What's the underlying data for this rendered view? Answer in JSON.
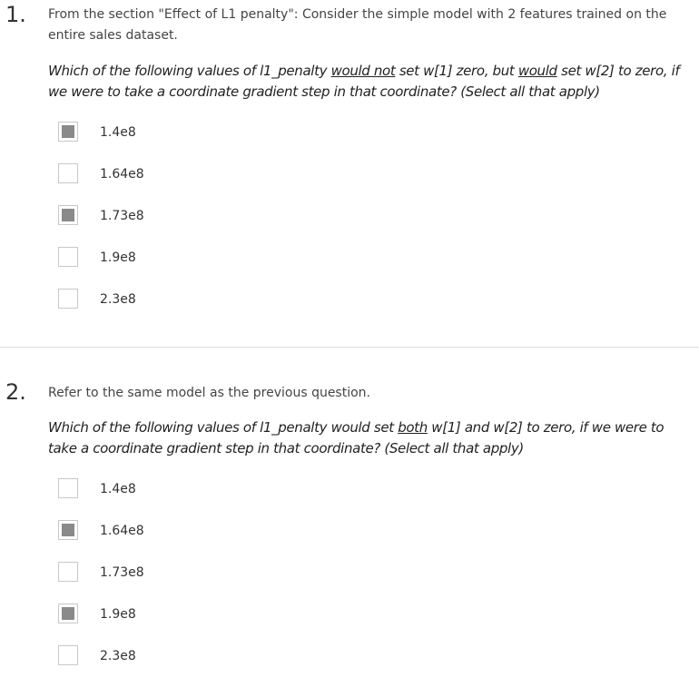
{
  "questions": [
    {
      "number": "1.",
      "intro": "From the section \"Effect of L1 penalty\": Consider the simple model with 2 features trained on the entire sales dataset.",
      "prompt_parts": [
        "Which of the following values of l1_penalty ",
        "would not",
        " set w[1] zero, but ",
        "would",
        " set w[2] to zero, if we were to take a coordinate gradient step in that coordinate? (Select all that apply)"
      ],
      "options": [
        {
          "label": "1.4e8",
          "checked": true
        },
        {
          "label": "1.64e8",
          "checked": false
        },
        {
          "label": "1.73e8",
          "checked": true
        },
        {
          "label": "1.9e8",
          "checked": false
        },
        {
          "label": "2.3e8",
          "checked": false
        }
      ]
    },
    {
      "number": "2.",
      "intro": "Refer to the same model as the previous question.",
      "prompt_parts": [
        "Which of the following values of l1_penalty would set ",
        "both",
        " w[1] and w[2] to zero, if we were to take a coordinate gradient step in that coordinate? (Select all that apply)"
      ],
      "options": [
        {
          "label": "1.4e8",
          "checked": false
        },
        {
          "label": "1.64e8",
          "checked": true
        },
        {
          "label": "1.73e8",
          "checked": false
        },
        {
          "label": "1.9e8",
          "checked": true
        },
        {
          "label": "2.3e8",
          "checked": false
        }
      ]
    }
  ]
}
